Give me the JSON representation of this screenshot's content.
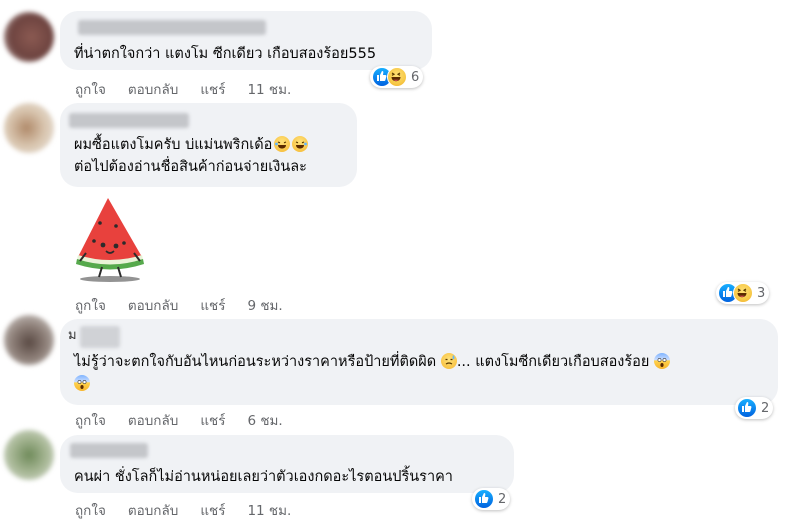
{
  "comments": [
    {
      "text_lines": [
        "ที่น่าตกใจกว่า แตงโม ซีกเดียว เกือบสองร้อย555"
      ],
      "actions": {
        "like": "ถูกใจ",
        "reply": "ตอบกลับ",
        "share": "แชร์",
        "time": "11 ชม."
      },
      "reaction_count": "6",
      "reaction_icons": [
        "like-icon",
        "haha-icon"
      ]
    },
    {
      "text_lines": [
        "ผมซื้อแตงโมครับ บ่แม่นพริกเด้อ",
        "ต่อไปต้องอ่านชื่อสินค้าก่อนจ่ายเงินละ"
      ],
      "sticker": "watermelon-sticker",
      "actions": {
        "like": "ถูกใจ",
        "reply": "ตอบกลับ",
        "share": "แชร์",
        "time": "9 ชม."
      },
      "reaction_count": "3",
      "reaction_icons": [
        "like-icon",
        "haha-icon"
      ]
    },
    {
      "name_fragment": "ม",
      "text_lines": [
        "ไม่รู้ว่าจะตกใจกับอันไหนก่อนระหว่างราคาหรือป้ายที่ติดผิด",
        "... แตงโมซีกเดียวเกือบสองร้อย"
      ],
      "actions": {
        "like": "ถูกใจ",
        "reply": "ตอบกลับ",
        "share": "แชร์",
        "time": "6 ชม."
      },
      "reaction_count": "2",
      "reaction_icons": [
        "like-icon"
      ]
    },
    {
      "text_lines": [
        "คนผ่า ชั่งโลก็ไม่อ่านหน่อยเลยว่าตัวเองกดอะไรตอนปริ้นราคา"
      ],
      "actions": {
        "like": "ถูกใจ",
        "reply": "ตอบกลับ",
        "share": "แชร์",
        "time": "11 ชม."
      },
      "reaction_count": "2",
      "reaction_icons": [
        "like-icon"
      ]
    }
  ]
}
